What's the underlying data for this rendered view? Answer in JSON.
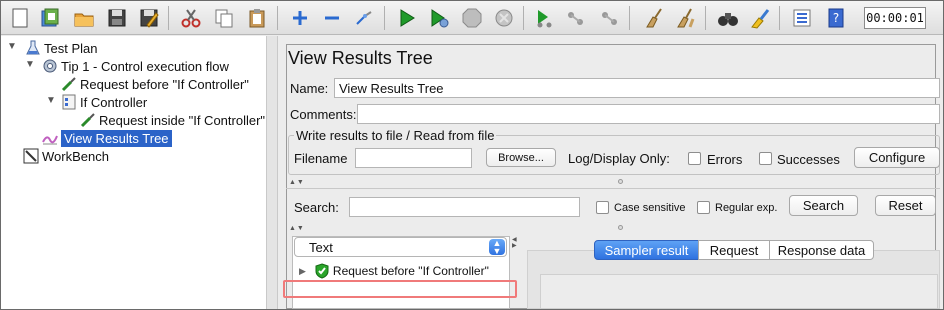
{
  "toolbar": {
    "buttons": [
      "new-icon",
      "templates-icon",
      "open-icon",
      "save-icon",
      "save-as-icon",
      "cut-icon",
      "copy-icon",
      "paste-icon",
      "expand-icon",
      "collapse-icon",
      "toggle-icon",
      "start-icon",
      "start-no-pause-icon",
      "stop-icon",
      "shutdown-icon",
      "remote-start-icon",
      "remote-stop-icon",
      "remote-exit-icon",
      "clear-icon",
      "clear-all-icon",
      "search-icon",
      "reset-search-icon",
      "function-helper-icon",
      "help-icon"
    ],
    "timer": "00:00:01"
  },
  "tree": {
    "test_plan": "Test Plan",
    "tip": "Tip 1 - Control execution flow",
    "request_before": "Request before \"If Controller\"",
    "if_controller": "If Controller",
    "request_inside": "Request inside \"If Controller\"",
    "view_results_tree": "View Results Tree",
    "workbench": "WorkBench"
  },
  "panel": {
    "title": "View Results Tree",
    "name_label": "Name:",
    "name_value": "View Results Tree",
    "comments_label": "Comments:",
    "comments_value": "",
    "write_group_title": "Write results to file / Read from file",
    "filename_label": "Filename",
    "filename_value": "",
    "browse_label": "Browse...",
    "log_display_label": "Log/Display Only:",
    "errors_label": "Errors",
    "successes_label": "Successes",
    "configure_label": "Configure",
    "search_label": "Search:",
    "search_value": "",
    "case_sensitive_label": "Case sensitive",
    "regex_label": "Regular exp.",
    "search_button": "Search",
    "reset_button": "Reset",
    "renderer_select": "Text",
    "result_item": "Request before \"If Controller\"",
    "tabs": [
      "Sampler result",
      "Request",
      "Response data"
    ]
  },
  "colors": {
    "selection": "#2b63c8",
    "active_tab": "#2f72e0",
    "highlight_box": "#f07a7a",
    "success_shield": "#2aa52a"
  }
}
